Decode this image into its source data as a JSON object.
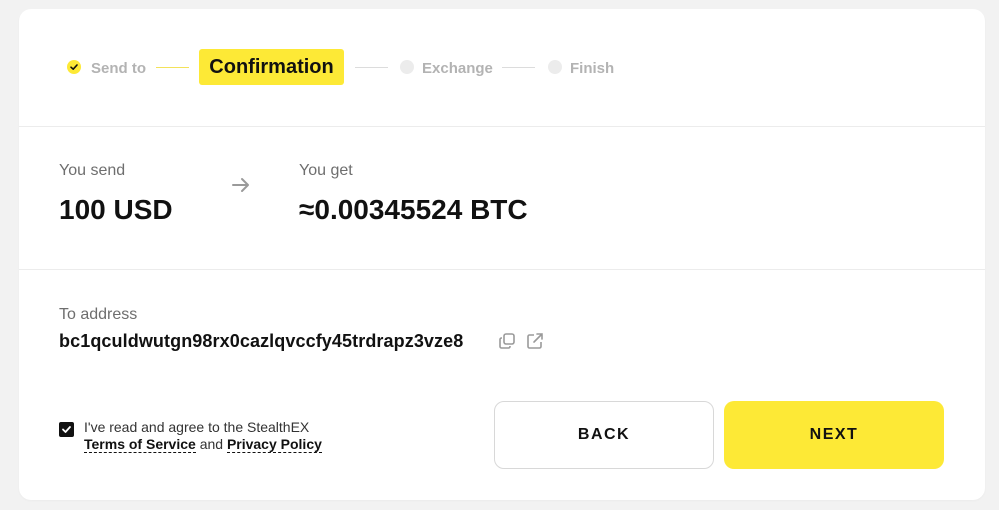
{
  "stepper": {
    "steps": [
      {
        "label": "Send to",
        "state": "done"
      },
      {
        "label": "Confirmation",
        "state": "active"
      },
      {
        "label": "Exchange",
        "state": "pending"
      },
      {
        "label": "Finish",
        "state": "pending"
      }
    ]
  },
  "exchange": {
    "send_label": "You send",
    "send_value": "100 USD",
    "get_label": "You get",
    "get_value": "≈0.00345524 BTC"
  },
  "address": {
    "label": "To address",
    "value": "bc1qculdwutgn98rx0cazlqvccfy45trdrapz3vze8"
  },
  "agreement": {
    "checked": true,
    "text": "I've read and agree to the StealthEX",
    "terms_link": "Terms of Service",
    "and_text": "and",
    "privacy_link": "Privacy Policy"
  },
  "buttons": {
    "back_label": "BACK",
    "next_label": "NEXT"
  },
  "colors": {
    "accent": "#fde936",
    "muted": "#b3b3b3",
    "text": "#111111"
  }
}
